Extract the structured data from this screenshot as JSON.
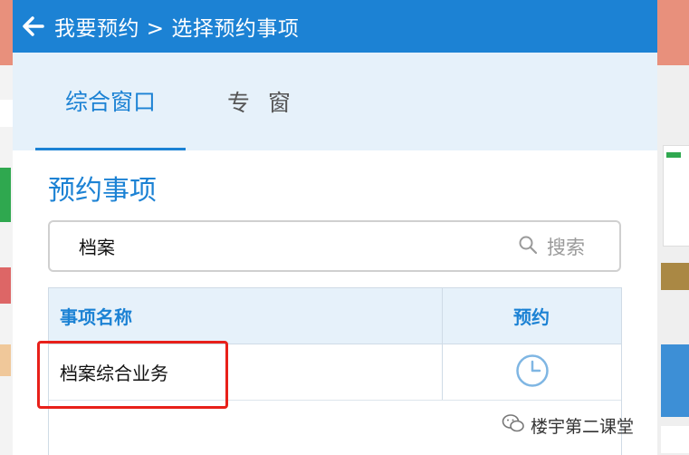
{
  "header": {
    "title": "我要预约 > 选择预约事项"
  },
  "tabs": [
    {
      "label": "综合窗口",
      "active": true
    },
    {
      "label": "专 窗",
      "active": false
    }
  ],
  "section": {
    "title": "预约事项"
  },
  "search": {
    "value": "档案",
    "button_label": "搜索"
  },
  "table": {
    "headers": {
      "name": "事项名称",
      "book": "预约"
    },
    "rows": [
      {
        "name": "档案综合业务"
      }
    ]
  },
  "watermark": {
    "text": "楼宇第二课堂"
  },
  "colors": {
    "primary": "#1c82d4",
    "tab_bg": "#e6f1fa",
    "highlight": "#e8201a"
  },
  "icons": {
    "back": "arrow-left-icon",
    "search": "search-icon",
    "book": "clock-icon",
    "watermark": "wechat-icon"
  }
}
